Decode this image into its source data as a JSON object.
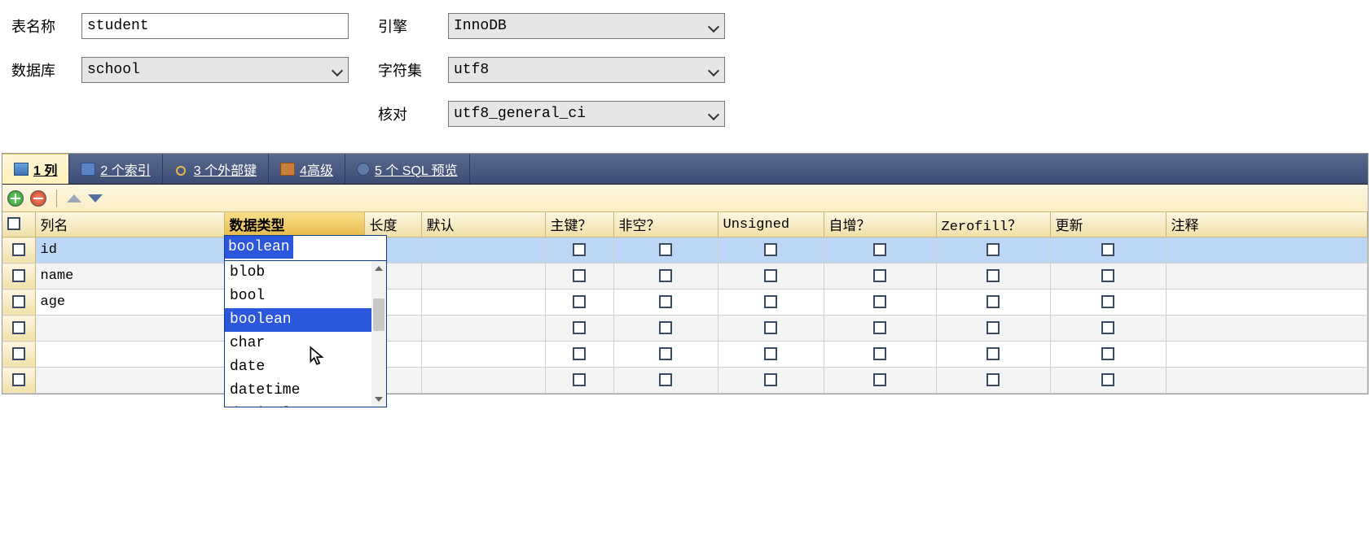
{
  "form": {
    "table_name_label": "表名称",
    "table_name_value": "student",
    "database_label": "数据库",
    "database_value": "school",
    "engine_label": "引擎",
    "engine_value": "InnoDB",
    "charset_label": "字符集",
    "charset_value": "utf8",
    "collation_label": "核对",
    "collation_value": "utf8_general_ci"
  },
  "tabs": {
    "columns": "1 列",
    "indexes": "2 个索引",
    "fkeys": "3 个外部键",
    "advanced": "4高级",
    "sql": "5 个 SQL 预览"
  },
  "grid_headers": {
    "name": "列名",
    "type": "数据类型",
    "length": "长度",
    "default": "默认",
    "pk": "主键？",
    "nn": "非空？",
    "unsigned": "Unsigned",
    "ai": "自增？",
    "zf": "Zerofill？",
    "update": "更新",
    "comment": "注释"
  },
  "rows": [
    {
      "name": "id",
      "type": "boolean",
      "selected": true
    },
    {
      "name": "name",
      "type": ""
    },
    {
      "name": "age",
      "type": ""
    },
    {
      "name": "",
      "type": ""
    },
    {
      "name": "",
      "type": ""
    },
    {
      "name": "",
      "type": ""
    }
  ],
  "datatype_cell_value": "boolean",
  "datatype_options": [
    "blob",
    "bool",
    "boolean",
    "char",
    "date",
    "datetime",
    "decimal"
  ],
  "datatype_highlight": "boolean"
}
